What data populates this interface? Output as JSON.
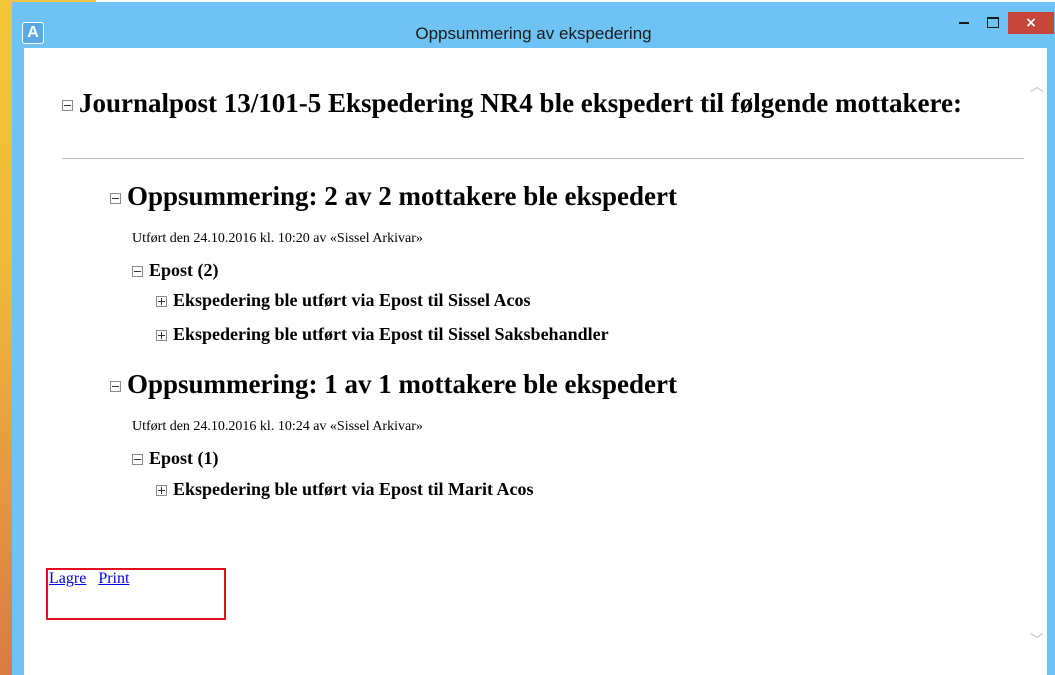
{
  "window": {
    "title": "Oppsummering av ekspedering",
    "app_icon_letter": "A",
    "close_symbol": "×"
  },
  "main": {
    "heading": "Journalpost 13/101-5 Ekspedering NR4 ble ekspedert til følgende mottakere:",
    "summaries": [
      {
        "title": "Oppsummering: 2 av 2 mottakere ble ekspedert",
        "meta": "Utført den 24.10.2016 kl. 10:20 av «Sissel Arkivar»",
        "group": "Epost (2)",
        "items": [
          "Ekspedering ble utført via Epost til Sissel Acos",
          "Ekspedering ble utført via Epost til Sissel Saksbehandler"
        ]
      },
      {
        "title": "Oppsummering: 1 av 1 mottakere ble ekspedert",
        "meta": "Utført den 24.10.2016 kl. 10:24 av «Sissel Arkivar»",
        "group": "Epost (1)",
        "items": [
          "Ekspedering ble utført via Epost til Marit Acos"
        ]
      }
    ]
  },
  "footer": {
    "save_link": "Lagre",
    "print_link": "Print"
  },
  "colors": {
    "titlebar": "#6fc3f4",
    "close_button": "#c7453a",
    "link": "#0000ee",
    "highlight": "#e0101f"
  }
}
